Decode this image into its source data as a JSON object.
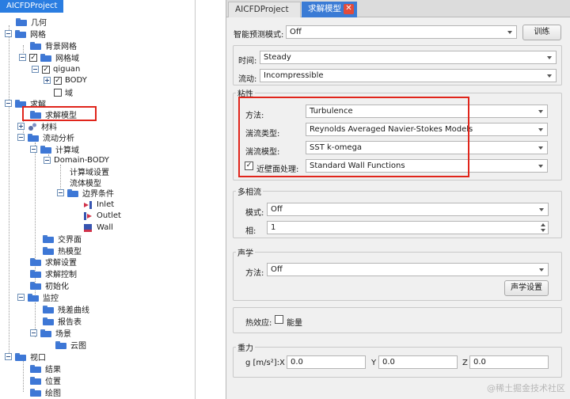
{
  "tree": {
    "title": "AICFDProject",
    "nodes": [
      {
        "label": "几何"
      },
      {
        "label": "网格"
      },
      {
        "label": "背景网格"
      },
      {
        "label": "网格域"
      },
      {
        "label": "qiguan"
      },
      {
        "label": "BODY"
      },
      {
        "label": "域"
      },
      {
        "label": "求解"
      },
      {
        "label": "求解模型"
      },
      {
        "label": "材料"
      },
      {
        "label": "流动分析"
      },
      {
        "label": "计算域"
      },
      {
        "label": "Domain-BODY"
      },
      {
        "label": "计算域设置"
      },
      {
        "label": "流体模型"
      },
      {
        "label": "边界条件"
      },
      {
        "label": "Inlet"
      },
      {
        "label": "Outlet"
      },
      {
        "label": "Wall"
      },
      {
        "label": "交界面"
      },
      {
        "label": "热模型"
      },
      {
        "label": "求解设置"
      },
      {
        "label": "求解控制"
      },
      {
        "label": "初始化"
      },
      {
        "label": "监控"
      },
      {
        "label": "残差曲线"
      },
      {
        "label": "报告表"
      },
      {
        "label": "场景"
      },
      {
        "label": "云图"
      },
      {
        "label": "视口"
      },
      {
        "label": "结果"
      },
      {
        "label": "位置"
      },
      {
        "label": "绘图"
      }
    ]
  },
  "tabs": {
    "project": "AICFDProject",
    "solver": "求解模型",
    "close": "✕"
  },
  "smart": {
    "label": "智能预测模式:",
    "value": "Off",
    "train_button": "训练"
  },
  "time": {
    "label": "时间:",
    "value": "Steady"
  },
  "flow": {
    "label": "流动:",
    "value": "Incompressible"
  },
  "viscous": {
    "title": "粘性",
    "method_label": "方法:",
    "method_value": "Turbulence",
    "type_label": "湍流类型:",
    "type_value": "Reynolds Averaged Navier-Stokes Models",
    "model_label": "湍流模型:",
    "model_value": "SST k-omega",
    "wall_label": "近壁面处理:",
    "wall_checked": "✓",
    "wall_value": "Standard Wall Functions"
  },
  "multiphase": {
    "title": "多相流",
    "mode_label": "模式:",
    "mode_value": "Off",
    "phase_label": "相:",
    "phase_value": "1"
  },
  "acoustics": {
    "title": "声学",
    "method_label": "方法:",
    "method_value": "Off",
    "settings_button": "声学设置"
  },
  "thermal": {
    "label": "热效应:",
    "energy_label": "能量"
  },
  "gravity": {
    "title": "重力",
    "unit_label": "g [m/s²]:",
    "x_label": "X",
    "x_value": "0.0",
    "y_label": "Y",
    "y_value": "0.0",
    "z_label": "Z",
    "z_value": "0.0"
  },
  "watermark": "@稀土掘金技术社区"
}
